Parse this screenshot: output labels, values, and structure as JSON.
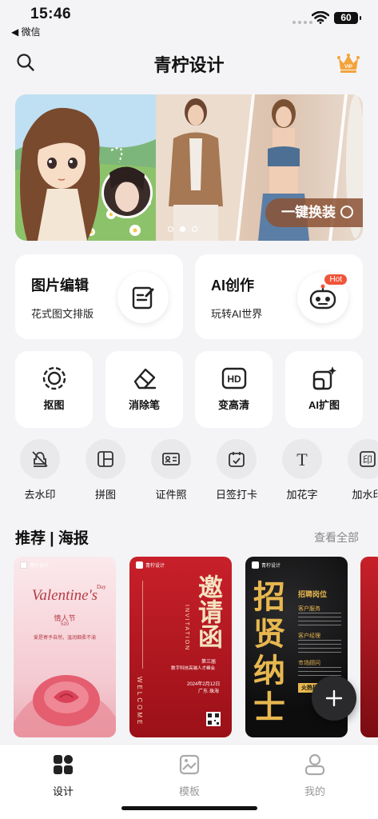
{
  "status_bar": {
    "time": "15:46",
    "back_app": "◀ 微信",
    "battery": "60"
  },
  "nav": {
    "title": "青柠设计",
    "search_icon": "search-icon",
    "vip_icon": "crown-icon"
  },
  "banner": {
    "cta": "一键换装",
    "page_count": 3,
    "active_page": 2
  },
  "feature_cards": [
    {
      "title": "图片编辑",
      "subtitle": "花式图文排版",
      "icon": "edit-doc-icon"
    },
    {
      "title": "AI创作",
      "subtitle": "玩转AI世界",
      "icon": "robot-icon",
      "badge": "Hot"
    }
  ],
  "tools": [
    {
      "label": "抠图",
      "icon": "cutout-icon"
    },
    {
      "label": "消除笔",
      "icon": "eraser-icon"
    },
    {
      "label": "变高清",
      "icon": "hd-icon"
    },
    {
      "label": "AI扩图",
      "icon": "ai-expand-icon"
    }
  ],
  "mini_tools": [
    {
      "label": "去水印",
      "icon": "remove-watermark-icon"
    },
    {
      "label": "拼图",
      "icon": "collage-icon"
    },
    {
      "label": "证件照",
      "icon": "id-photo-icon"
    },
    {
      "label": "日签打卡",
      "icon": "calendar-icon"
    },
    {
      "label": "加花字",
      "icon": "text-icon"
    },
    {
      "label": "加水印",
      "icon": "watermark-icon"
    }
  ],
  "section": {
    "title": "推荐 | 海报",
    "more": "查看全部"
  },
  "posters": [
    {
      "brand": "青柠设计",
      "title": "Valentine's",
      "day": "Day",
      "cn_title": "情人节",
      "date": "520",
      "line": "爱是寄予自然，温润细柔不渝",
      "accent": "#c0392b"
    },
    {
      "brand": "青柠设计",
      "title": "邀请函",
      "en": "INVITATION",
      "welcome": "WELCOME",
      "edition": "第三届",
      "event": "数字科技高端人才峰会",
      "date": "2024年2月12日",
      "place": "广东·珠海",
      "accent": "#b0161e"
    },
    {
      "brand": "青柠设计",
      "title": "招贤纳士",
      "heading": "招聘岗位",
      "job1": "客户服务",
      "job2": "客户经理",
      "job3": "市场顾问",
      "tag": "火热招",
      "accent": "#d9a441"
    }
  ],
  "tabbar": [
    {
      "label": "设计",
      "icon": "design-grid-icon",
      "active": true
    },
    {
      "label": "模板",
      "icon": "template-icon",
      "active": false
    },
    {
      "label": "我的",
      "icon": "profile-icon",
      "active": false
    }
  ]
}
